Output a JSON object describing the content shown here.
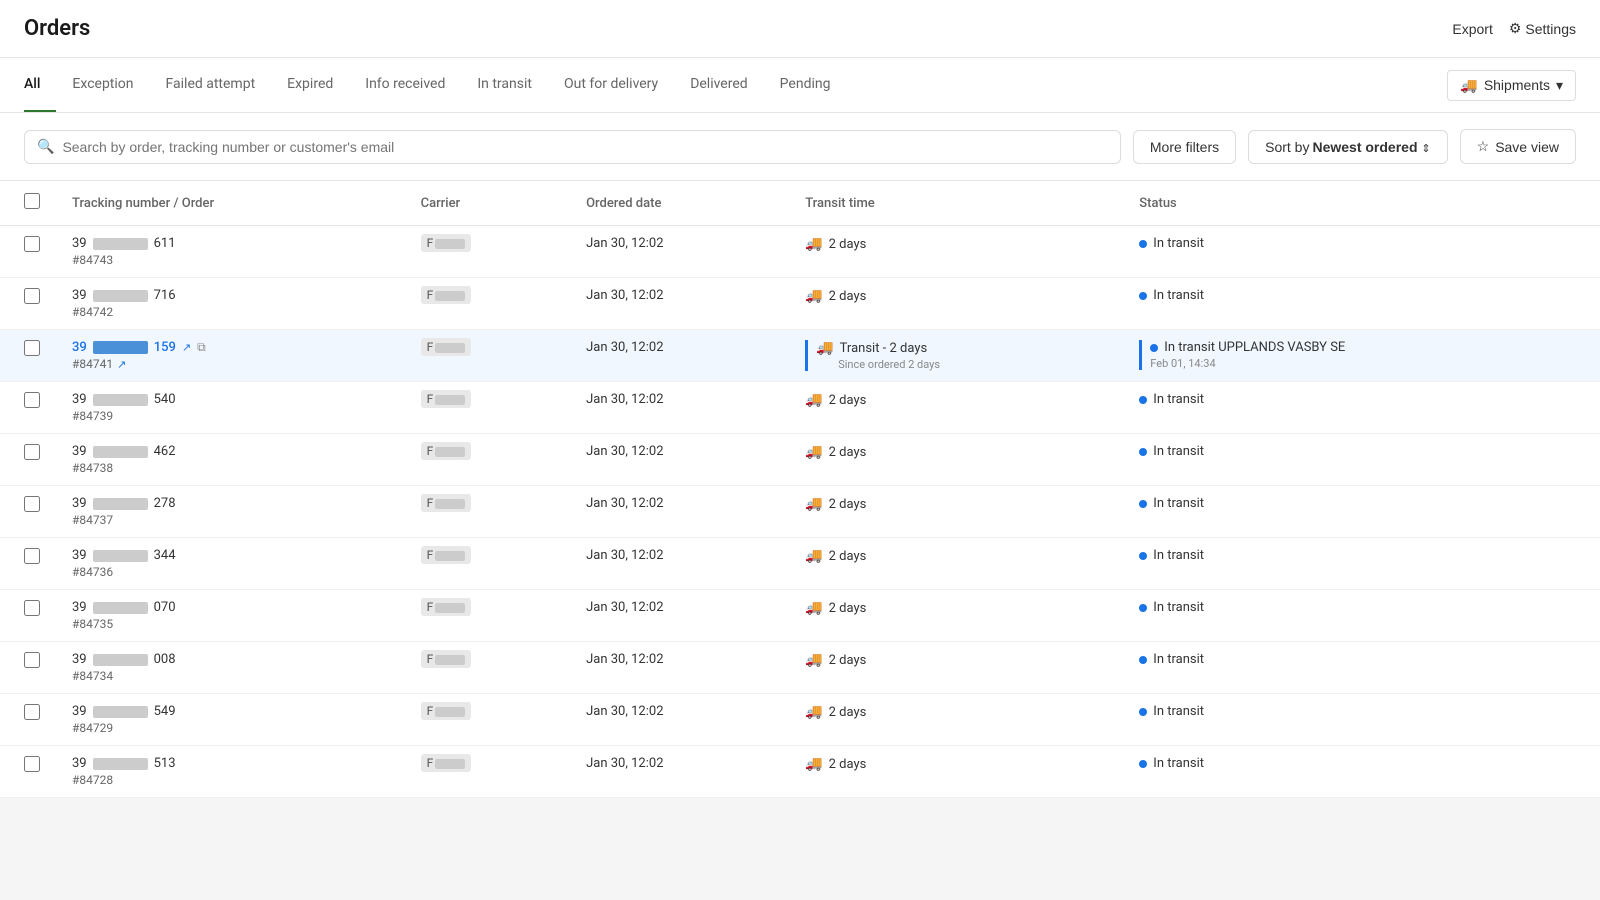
{
  "header": {
    "title": "Orders",
    "export_label": "Export",
    "settings_label": "Settings"
  },
  "tabs": {
    "items": [
      {
        "id": "all",
        "label": "All",
        "active": true
      },
      {
        "id": "exception",
        "label": "Exception"
      },
      {
        "id": "failed_attempt",
        "label": "Failed attempt"
      },
      {
        "id": "expired",
        "label": "Expired"
      },
      {
        "id": "info_received",
        "label": "Info received"
      },
      {
        "id": "in_transit",
        "label": "In transit"
      },
      {
        "id": "out_for_delivery",
        "label": "Out for delivery"
      },
      {
        "id": "delivered",
        "label": "Delivered"
      },
      {
        "id": "pending",
        "label": "Pending"
      }
    ],
    "shipments_label": "Shipments"
  },
  "toolbar": {
    "search_placeholder": "Search by order, tracking number or customer's email",
    "more_filters_label": "More filters",
    "sort_label": "Sort by Newest ordered ⇕",
    "save_view_label": "Save view"
  },
  "table": {
    "columns": [
      {
        "id": "checkbox",
        "label": ""
      },
      {
        "id": "tracking",
        "label": "Tracking number / Order"
      },
      {
        "id": "carrier",
        "label": "Carrier"
      },
      {
        "id": "ordered_date",
        "label": "Ordered date"
      },
      {
        "id": "transit_time",
        "label": "Transit time"
      },
      {
        "id": "status",
        "label": "Status"
      }
    ],
    "rows": [
      {
        "id": 1,
        "tracking_prefix": "39",
        "tracking_suffix": "611",
        "redacted_width": 55,
        "order": "#84743",
        "carrier": "F",
        "ordered_date": "Jan 30, 12:02",
        "transit_days": "2 days",
        "status": "In transit",
        "status_color": "blue",
        "highlighted": false,
        "show_expanded": false
      },
      {
        "id": 2,
        "tracking_prefix": "39",
        "tracking_suffix": "716",
        "redacted_width": 55,
        "order": "#84742",
        "carrier": "F",
        "ordered_date": "Jan 30, 12:02",
        "transit_days": "2 days",
        "status": "In transit",
        "status_color": "blue",
        "highlighted": false,
        "show_expanded": false
      },
      {
        "id": 3,
        "tracking_prefix": "39",
        "tracking_suffix": "159",
        "redacted_width": 55,
        "order": "#84741",
        "carrier": "F",
        "ordered_date": "Jan 30, 12:02",
        "transit_days": "Transit - 2 days",
        "transit_sub": "Since ordered 2 days",
        "status": "In transit UPPLANDS VASBY SE",
        "status_sub": "Feb 01, 14:34",
        "status_color": "blue",
        "highlighted": true,
        "show_expanded": true
      },
      {
        "id": 4,
        "tracking_prefix": "39",
        "tracking_suffix": "540",
        "redacted_width": 55,
        "order": "#84739",
        "carrier": "F",
        "ordered_date": "Jan 30, 12:02",
        "transit_days": "2 days",
        "status": "In transit",
        "status_color": "blue",
        "highlighted": false,
        "show_expanded": false
      },
      {
        "id": 5,
        "tracking_prefix": "39",
        "tracking_suffix": "462",
        "redacted_width": 55,
        "order": "#84738",
        "carrier": "F",
        "ordered_date": "Jan 30, 12:02",
        "transit_days": "2 days",
        "status": "In transit",
        "status_color": "blue",
        "highlighted": false,
        "show_expanded": false
      },
      {
        "id": 6,
        "tracking_prefix": "39",
        "tracking_suffix": "278",
        "redacted_width": 55,
        "order": "#84737",
        "carrier": "F",
        "ordered_date": "Jan 30, 12:02",
        "transit_days": "2 days",
        "status": "In transit",
        "status_color": "blue",
        "highlighted": false,
        "show_expanded": false
      },
      {
        "id": 7,
        "tracking_prefix": "39",
        "tracking_suffix": "344",
        "redacted_width": 55,
        "order": "#84736",
        "carrier": "F",
        "ordered_date": "Jan 30, 12:02",
        "transit_days": "2 days",
        "status": "In transit",
        "status_color": "blue",
        "highlighted": false,
        "show_expanded": false
      },
      {
        "id": 8,
        "tracking_prefix": "39",
        "tracking_suffix": "070",
        "redacted_width": 55,
        "order": "#84735",
        "carrier": "F",
        "ordered_date": "Jan 30, 12:02",
        "transit_days": "2 days",
        "status": "In transit",
        "status_color": "blue",
        "highlighted": false,
        "show_expanded": false
      },
      {
        "id": 9,
        "tracking_prefix": "39",
        "tracking_suffix": "008",
        "redacted_width": 55,
        "order": "#84734",
        "carrier": "F",
        "ordered_date": "Jan 30, 12:02",
        "transit_days": "2 days",
        "status": "In transit",
        "status_color": "blue",
        "highlighted": false,
        "show_expanded": false
      },
      {
        "id": 10,
        "tracking_prefix": "39",
        "tracking_suffix": "549",
        "redacted_width": 55,
        "order": "#84729",
        "carrier": "F",
        "ordered_date": "Jan 30, 12:02",
        "transit_days": "2 days",
        "status": "In transit",
        "status_color": "blue",
        "highlighted": false,
        "show_expanded": false
      },
      {
        "id": 11,
        "tracking_prefix": "39",
        "tracking_suffix": "513",
        "redacted_width": 55,
        "order": "#84728",
        "carrier": "F",
        "ordered_date": "Jan 30, 12:02",
        "transit_days": "2 days",
        "status": "In transit",
        "status_color": "blue",
        "highlighted": false,
        "show_expanded": false
      }
    ]
  }
}
